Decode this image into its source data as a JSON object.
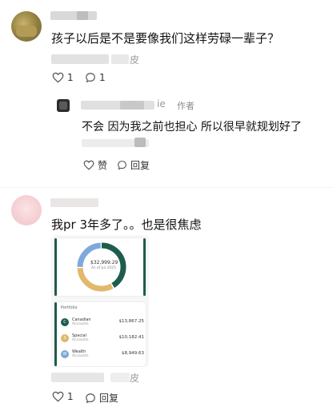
{
  "comment1": {
    "text": "孩子以后是不是要像我们这样劳碌一辈子？",
    "likes": "1",
    "replies": "1"
  },
  "reply1": {
    "author_suffix": "ie",
    "author_tag": "作者",
    "text": "不会 因为我之前也担心 所以很早就规划好了",
    "like_label": "赞",
    "reply_label": "回复"
  },
  "comment2": {
    "text": "我pr 3年多了。。也是很焦虑",
    "likes": "1",
    "reply_label": "回复",
    "meta_suffix": "皮",
    "image": {
      "total_value": "$32,999.29",
      "total_sub": "As of Jul 2025",
      "list_header": "Portfolio",
      "rows": [
        {
          "name": "Canadian",
          "sub": "Accounts",
          "value": "$13,867.25",
          "badge": "C",
          "color": "#1e5c4e"
        },
        {
          "name": "Special",
          "sub": "Accounts",
          "value": "$10,182.41",
          "badge": "S",
          "color": "#e0b66b"
        },
        {
          "name": "Wealth",
          "sub": "Accounts",
          "value": "$8,949.63",
          "badge": "W",
          "color": "#7aa7d8"
        }
      ],
      "donut": {
        "segments": [
          {
            "label": "Green",
            "value": 42,
            "color": "#1e5c4e"
          },
          {
            "label": "Yellow",
            "value": 33,
            "color": "#e2b86b"
          },
          {
            "label": "Blue",
            "value": 25,
            "color": "#7fa9dd"
          }
        ]
      }
    }
  },
  "icons": {
    "like": "heart-icon",
    "reply": "comment-bubble-icon"
  },
  "colors": {
    "meta_gray": "#9a9a9a",
    "blur_light": "#e3e3e3",
    "blur_mid": "#cfcfcf"
  }
}
